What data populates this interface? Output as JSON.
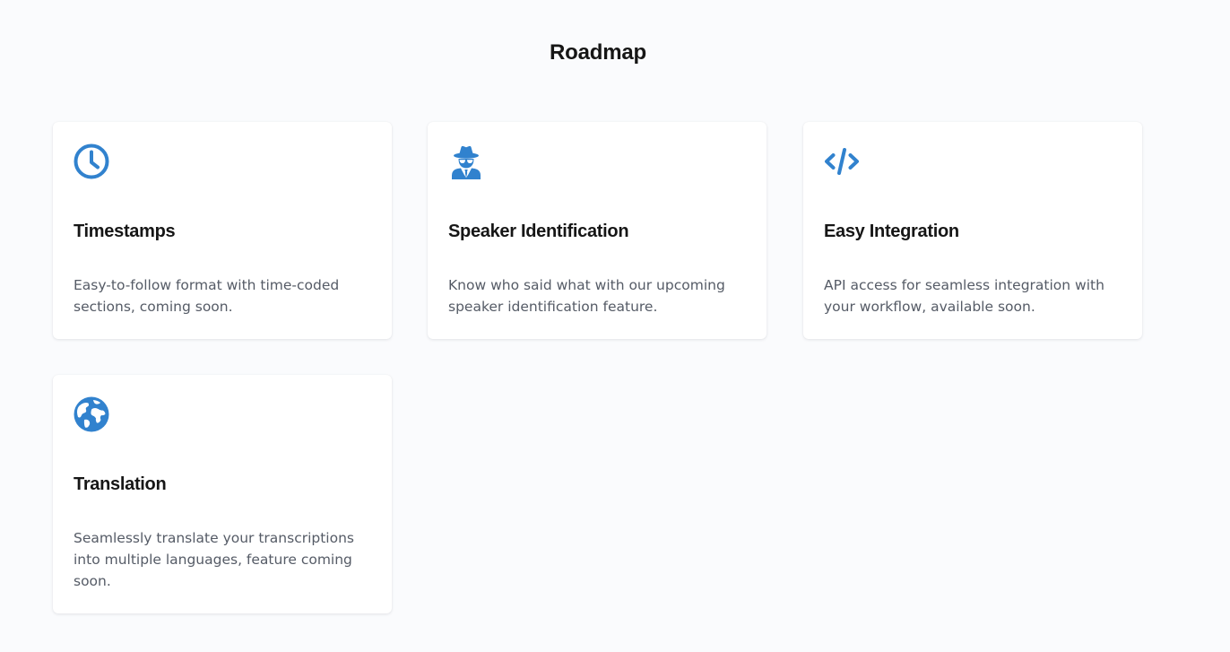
{
  "page": {
    "title": "Roadmap",
    "accent_color": "#3182ce",
    "background_color": "#fafbfd"
  },
  "features": [
    {
      "icon": "clock-icon",
      "title": "Timestamps",
      "description": "Easy-to-follow format with time-coded sections, coming soon."
    },
    {
      "icon": "user-secret-icon",
      "title": "Speaker Identification",
      "description": "Know who said what with our upcoming speaker identification feature."
    },
    {
      "icon": "code-icon",
      "title": "Easy Integration",
      "description": "API access for seamless integration with your workflow, available soon."
    },
    {
      "icon": "globe-icon",
      "title": "Translation",
      "description": "Seamlessly translate your transcriptions into multiple languages, feature coming soon."
    }
  ]
}
